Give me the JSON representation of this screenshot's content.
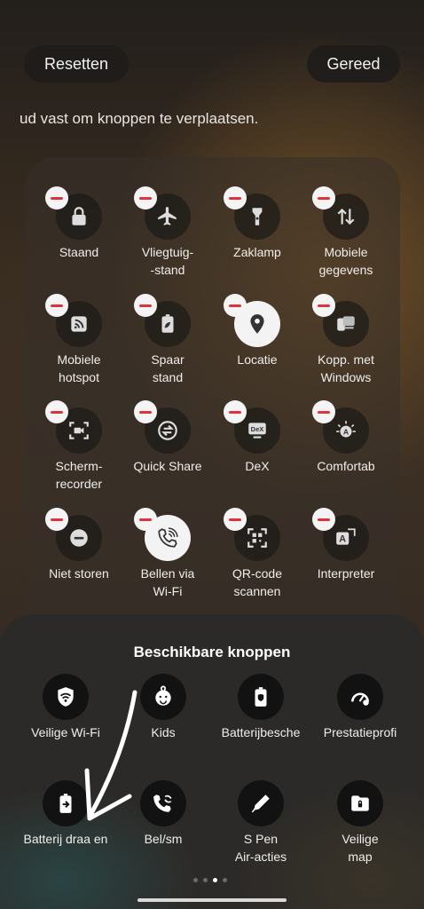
{
  "header": {
    "reset_label": "Resetten",
    "done_label": "Gereed"
  },
  "hint": "ud vast om knoppen te verplaatsen.",
  "active_tiles": [
    {
      "label": "Staand",
      "icon": "lock-icon"
    },
    {
      "label": "Vliegtuig-\n-stand",
      "icon": "airplane-icon"
    },
    {
      "label": "Zaklamp",
      "icon": "flashlight-icon"
    },
    {
      "label": "Mobiele\ngegevens",
      "icon": "mobile-data-icon"
    },
    {
      "label": "Mobiele\nhotspot",
      "icon": "hotspot-icon"
    },
    {
      "label": "Spaar\nstand",
      "icon": "power-saving-icon"
    },
    {
      "label": "Locatie",
      "icon": "location-icon"
    },
    {
      "label": "Kopp. met\nWindows",
      "icon": "link-windows-icon"
    },
    {
      "label": "Scherm-\nrecorder",
      "icon": "screen-recorder-icon"
    },
    {
      "label": "Quick Share",
      "icon": "quick-share-icon"
    },
    {
      "label": "DeX",
      "icon": "dex-icon"
    },
    {
      "label": "Comfortab",
      "icon": "eye-comfort-icon"
    },
    {
      "label": "Niet storen",
      "icon": "do-not-disturb-icon"
    },
    {
      "label": "Bellen via\nWi-Fi",
      "icon": "wifi-calling-icon"
    },
    {
      "label": "QR-code\nscannen",
      "icon": "qr-scan-icon"
    },
    {
      "label": "Interpreter",
      "icon": "interpreter-icon"
    }
  ],
  "available": {
    "title": "Beschikbare knoppen",
    "items": [
      {
        "label": "Veilige Wi-Fi",
        "icon": "secure-wifi-icon"
      },
      {
        "label": "Kids",
        "icon": "kids-icon"
      },
      {
        "label": "Batterijbesche",
        "icon": "battery-protect-icon"
      },
      {
        "label": "Prestatieprofi",
        "icon": "performance-icon"
      },
      {
        "label": "Batterij draa      en",
        "icon": "battery-share-icon"
      },
      {
        "label": "Bel/sm",
        "icon": "call-sync-icon"
      },
      {
        "label": "S Pen\nAir-acties",
        "icon": "spen-icon"
      },
      {
        "label": "Veilige\nmap",
        "icon": "secure-folder-icon"
      }
    ]
  },
  "pager": {
    "pages": 4,
    "current": 3
  }
}
